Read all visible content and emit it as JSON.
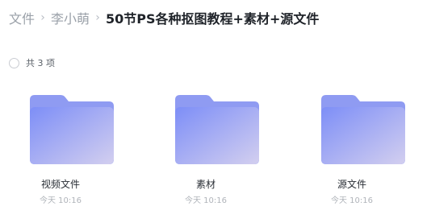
{
  "breadcrumb": {
    "items": [
      "文件",
      "李小萌"
    ],
    "current": "50节PS各种抠图教程+素材+源文件",
    "separator": "›"
  },
  "summary": {
    "count_label": "共 3 项"
  },
  "files": [
    {
      "name": "视频文件",
      "time": "今天 10:16",
      "icon": "folder-icon"
    },
    {
      "name": "素材",
      "time": "今天 10:16",
      "icon": "folder-icon"
    },
    {
      "name": "源文件",
      "time": "今天 10:16",
      "icon": "folder-icon"
    }
  ],
  "colors": {
    "folder_back": "#8f9bf2",
    "folder_front_start": "#7d8ef7",
    "folder_front_end": "#d3cfef",
    "title_text": "#1f2329",
    "muted_text": "#9aa0a8"
  }
}
